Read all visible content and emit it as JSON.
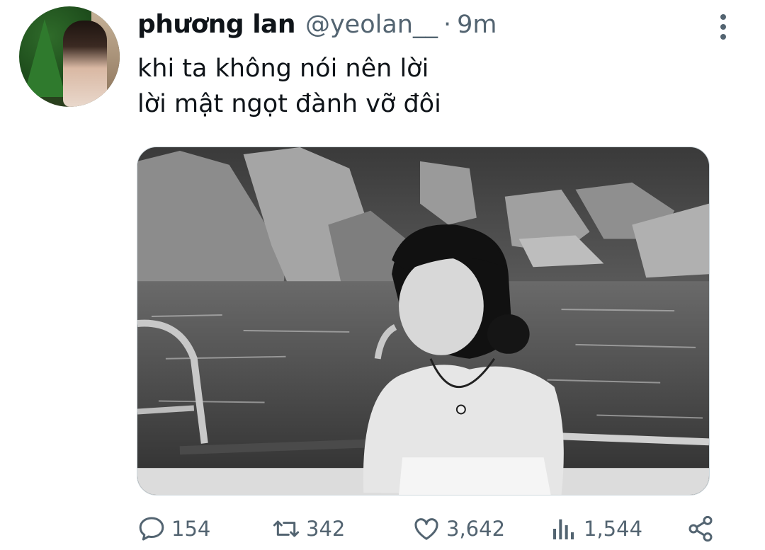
{
  "tweet": {
    "display_name": "phương lan",
    "handle": "@yeolan__",
    "separator": "·",
    "time": "9m",
    "text_lines": [
      "khi ta không nói nên lời",
      "lời mật ngọt đành vỡ đôi"
    ],
    "avatar_icon": "profile-avatar",
    "media": {
      "description_icon": "photo",
      "style": "black-and-white"
    }
  },
  "actions": {
    "reply_count": "154",
    "retweet_count": "342",
    "like_count": "3,642",
    "views_count": "1,544"
  },
  "icons": {
    "more": "more-vertical-icon",
    "reply": "reply-icon",
    "retweet": "retweet-icon",
    "like": "heart-icon",
    "views": "analytics-icon",
    "share": "share-icon"
  },
  "colors": {
    "text_primary": "#0f1419",
    "text_secondary": "#536471",
    "border": "#cfd9de",
    "background": "#ffffff"
  }
}
